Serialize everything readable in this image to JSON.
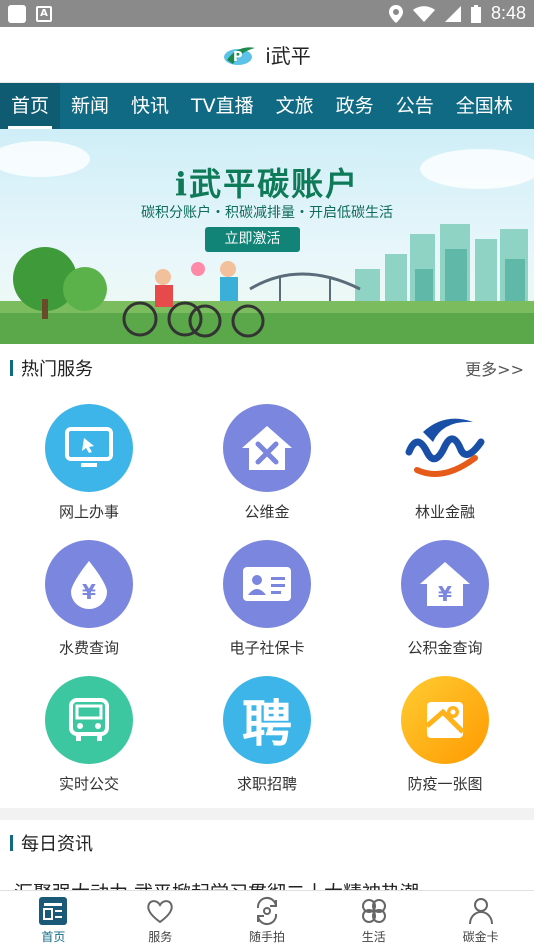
{
  "status_bar": {
    "time": "8:48",
    "app_icon_letter": "A"
  },
  "header": {
    "app_name": "i武平"
  },
  "tabs": [
    {
      "label": "首页",
      "active": true
    },
    {
      "label": "新闻"
    },
    {
      "label": "快讯"
    },
    {
      "label": "TV直播"
    },
    {
      "label": "文旅"
    },
    {
      "label": "政务"
    },
    {
      "label": "公告"
    },
    {
      "label": "全国林"
    }
  ],
  "banner": {
    "title": "i武平碳账户",
    "subtitle": "碳积分账户・积碳减排量・开启低碳生活",
    "button": "立即激活"
  },
  "hot_services": {
    "title": "热门服务",
    "more": "更多>>",
    "items": [
      {
        "label": "网上办事",
        "icon": "monitor-icon",
        "color": "#3db5e8"
      },
      {
        "label": "公维金",
        "icon": "house-tools-icon",
        "color": "#7b86de"
      },
      {
        "label": "林业金融",
        "icon": "forestry-logo-icon",
        "color": "#ffffff"
      },
      {
        "label": "水费查询",
        "icon": "water-drop-yen-icon",
        "color": "#7b86de"
      },
      {
        "label": "电子社保卡",
        "icon": "id-card-icon",
        "color": "#7b86de"
      },
      {
        "label": "公积金查询",
        "icon": "house-yen-icon",
        "color": "#7b86de"
      },
      {
        "label": "实时公交",
        "icon": "bus-icon",
        "color": "#3cc7a0"
      },
      {
        "label": "求职招聘",
        "icon": "recruit-icon",
        "color": "#3db5e8",
        "glyph": "聘"
      },
      {
        "label": "防疫一张图",
        "icon": "epidemic-map-icon",
        "color": "#ffb21a"
      }
    ]
  },
  "daily_news": {
    "title": "每日资讯",
    "first_headline": "汇聚强大动力 武平掀起学习贯彻二十大精神热潮"
  },
  "bottom_nav": [
    {
      "label": "首页",
      "icon": "home-icon",
      "active": true
    },
    {
      "label": "服务",
      "icon": "heart-hand-icon"
    },
    {
      "label": "随手拍",
      "icon": "camera-swap-icon"
    },
    {
      "label": "生活",
      "icon": "clover-icon"
    },
    {
      "label": "碳金卡",
      "icon": "person-icon"
    }
  ]
}
